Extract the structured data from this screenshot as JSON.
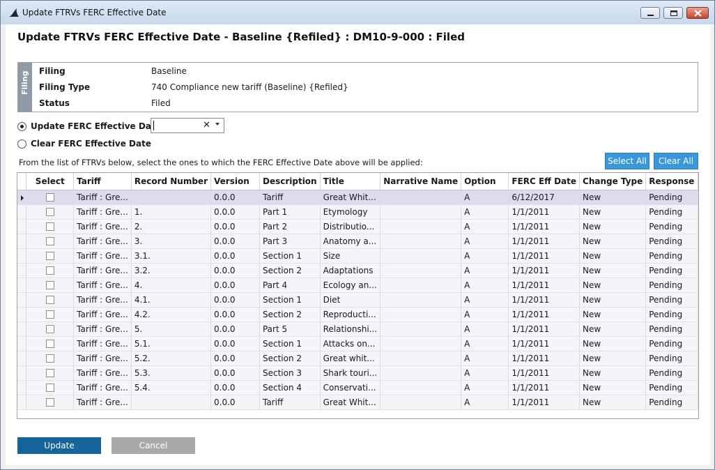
{
  "window": {
    "title": "Update FTRVs FERC Effective Date",
    "app_icon": "shark-fin-icon",
    "controls": [
      "minimize-icon",
      "maximize-icon",
      "close-icon"
    ]
  },
  "heading": "Update FTRVs FERC Effective Date - Baseline {Refiled} : DM10-9-000 : Filed",
  "filing": {
    "tab_label": "Filing",
    "fields": [
      {
        "label": "Filing",
        "value": "Baseline"
      },
      {
        "label": "Filing Type",
        "value": "740 Compliance new tariff (Baseline) {Refiled}"
      },
      {
        "label": "Status",
        "value": "Filed"
      }
    ]
  },
  "options": {
    "update_label": "Update FERC Effective Date:",
    "update_selected": true,
    "date_value": "",
    "clear_glyph": "✕",
    "clear_label": "Clear FERC Effective Date",
    "clear_selected": false
  },
  "instruction": "From the list of FTRVs below, select the ones to which the FERC Effective Date above will be applied:",
  "buttons": {
    "select_all": "Select All",
    "clear_all": "Clear All",
    "update": "Update",
    "cancel": "Cancel"
  },
  "colors": {
    "accent_blue": "#3a97d9",
    "update_button": "#15649b",
    "cancel_button": "#a9a9a9",
    "current_row": "#dcdcee",
    "row_background": "#f4f4f9"
  },
  "grid": {
    "columns": [
      "Select",
      "Tariff",
      "Record Number",
      "Version",
      "Description",
      "Title",
      "Narrative Name",
      "Option",
      "FERC Eff Date",
      "Change Type",
      "Response"
    ],
    "current_row_index": 0,
    "rows": [
      {
        "selected": false,
        "tariff": "Tariff : Gre...",
        "record": "",
        "version": "0.0.0",
        "description": "Tariff",
        "title": "Great Whit...",
        "narrative": "",
        "option": "A",
        "date": "6/12/2017",
        "change": "New",
        "response": "Pending"
      },
      {
        "selected": false,
        "tariff": "Tariff : Gre...",
        "record": "1.",
        "version": "0.0.0",
        "description": "Part 1",
        "title": "Etymology",
        "narrative": "",
        "option": "A",
        "date": "1/1/2011",
        "change": "New",
        "response": "Pending"
      },
      {
        "selected": false,
        "tariff": "Tariff : Gre...",
        "record": "2.",
        "version": "0.0.0",
        "description": "Part 2",
        "title": "Distributio...",
        "narrative": "",
        "option": "A",
        "date": "1/1/2011",
        "change": "New",
        "response": "Pending"
      },
      {
        "selected": false,
        "tariff": "Tariff : Gre...",
        "record": "3.",
        "version": "0.0.0",
        "description": "Part 3",
        "title": "Anatomy a...",
        "narrative": "",
        "option": "A",
        "date": "1/1/2011",
        "change": "New",
        "response": "Pending"
      },
      {
        "selected": false,
        "tariff": "Tariff : Gre...",
        "record": "3.1.",
        "version": "0.0.0",
        "description": "Section 1",
        "title": "Size",
        "narrative": "",
        "option": "A",
        "date": "1/1/2011",
        "change": "New",
        "response": "Pending"
      },
      {
        "selected": false,
        "tariff": "Tariff : Gre...",
        "record": "3.2.",
        "version": "0.0.0",
        "description": "Section 2",
        "title": "Adaptations",
        "narrative": "",
        "option": "A",
        "date": "1/1/2011",
        "change": "New",
        "response": "Pending"
      },
      {
        "selected": false,
        "tariff": "Tariff : Gre...",
        "record": "4.",
        "version": "0.0.0",
        "description": "Part 4",
        "title": "Ecology an...",
        "narrative": "",
        "option": "A",
        "date": "1/1/2011",
        "change": "New",
        "response": "Pending"
      },
      {
        "selected": false,
        "tariff": "Tariff : Gre...",
        "record": "4.1.",
        "version": "0.0.0",
        "description": "Section 1",
        "title": "Diet",
        "narrative": "",
        "option": "A",
        "date": "1/1/2011",
        "change": "New",
        "response": "Pending"
      },
      {
        "selected": false,
        "tariff": "Tariff : Gre...",
        "record": "4.2.",
        "version": "0.0.0",
        "description": "Section 2",
        "title": "Reproducti...",
        "narrative": "",
        "option": "A",
        "date": "1/1/2011",
        "change": "New",
        "response": "Pending"
      },
      {
        "selected": false,
        "tariff": "Tariff : Gre...",
        "record": "5.",
        "version": "0.0.0",
        "description": "Part 5",
        "title": "Relationshi...",
        "narrative": "",
        "option": "A",
        "date": "1/1/2011",
        "change": "New",
        "response": "Pending"
      },
      {
        "selected": false,
        "tariff": "Tariff : Gre...",
        "record": "5.1.",
        "version": "0.0.0",
        "description": "Section 1",
        "title": "Attacks on...",
        "narrative": "",
        "option": "A",
        "date": "1/1/2011",
        "change": "New",
        "response": "Pending"
      },
      {
        "selected": false,
        "tariff": "Tariff : Gre...",
        "record": "5.2.",
        "version": "0.0.0",
        "description": "Section 2",
        "title": "Great whit...",
        "narrative": "",
        "option": "A",
        "date": "1/1/2011",
        "change": "New",
        "response": "Pending"
      },
      {
        "selected": false,
        "tariff": "Tariff : Gre...",
        "record": "5.3.",
        "version": "0.0.0",
        "description": "Section 3",
        "title": "Shark touri...",
        "narrative": "",
        "option": "A",
        "date": "1/1/2011",
        "change": "New",
        "response": "Pending"
      },
      {
        "selected": false,
        "tariff": "Tariff : Gre...",
        "record": "5.4.",
        "version": "0.0.0",
        "description": "Section 4",
        "title": "Conservati...",
        "narrative": "",
        "option": "A",
        "date": "1/1/2011",
        "change": "New",
        "response": "Pending"
      },
      {
        "selected": false,
        "tariff": "Tariff : Gre...",
        "record": "",
        "version": "0.0.0",
        "description": "Tariff",
        "title": "Great Whit...",
        "narrative": "",
        "option": "A",
        "date": "1/1/2011",
        "change": "New",
        "response": "Pending"
      }
    ]
  }
}
